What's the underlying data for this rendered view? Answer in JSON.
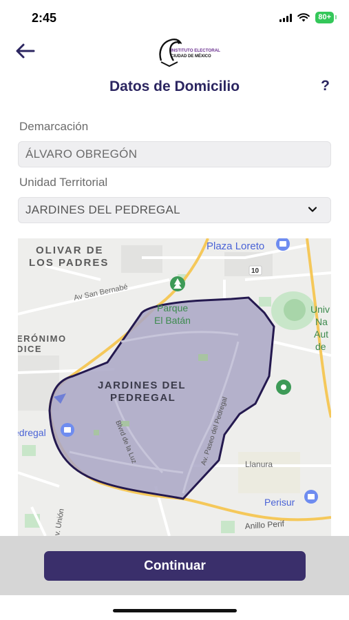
{
  "status_bar": {
    "time": "2:45",
    "battery": "80+"
  },
  "header": {
    "logo_line1": "INSTITUTO ELECTORAL",
    "logo_line2": "CIUDAD DE MÉXICO",
    "title": "Datos de Domicilio",
    "help_label": "?"
  },
  "form": {
    "demarcacion_label": "Demarcación",
    "demarcacion_value": "ÁLVARO OBREGÓN",
    "unidad_label": "Unidad Territorial",
    "unidad_value": "JARDINES DEL PEDREGAL"
  },
  "map": {
    "labels": {
      "olivar_line1": "OLIVAR DE",
      "olivar_line2": "LOS PADRES",
      "plaza_loreto": "Plaza Loreto",
      "road_10": "10",
      "av_san_bernabe": "Av San Bernabé",
      "parque_line1": "Parque",
      "parque_line2": "El Batán",
      "jeronimo_line1": "ERÓNIMO",
      "jeronimo_line2": "DICE",
      "unam_1": "Univ",
      "unam_2": "Na",
      "unam_3": "Aut",
      "unam_4": "de",
      "jardines_line1": "JARDINES DEL",
      "jardines_line2": "PEDREGAL",
      "pedregal_left": "edregal",
      "blvd_luz": "Blvrd de la Luz",
      "paseo_pedregal": "Av. Paseo del Pedregal",
      "llanura": "Llanura",
      "perisur": "Perisur",
      "union": "v. Unión",
      "anillo": "Anillo Perif"
    },
    "colors": {
      "polygon_fill": "#a9a6c6",
      "polygon_stroke": "#24194f",
      "highway": "#f5c85a"
    }
  },
  "footer": {
    "continue_label": "Continuar"
  }
}
